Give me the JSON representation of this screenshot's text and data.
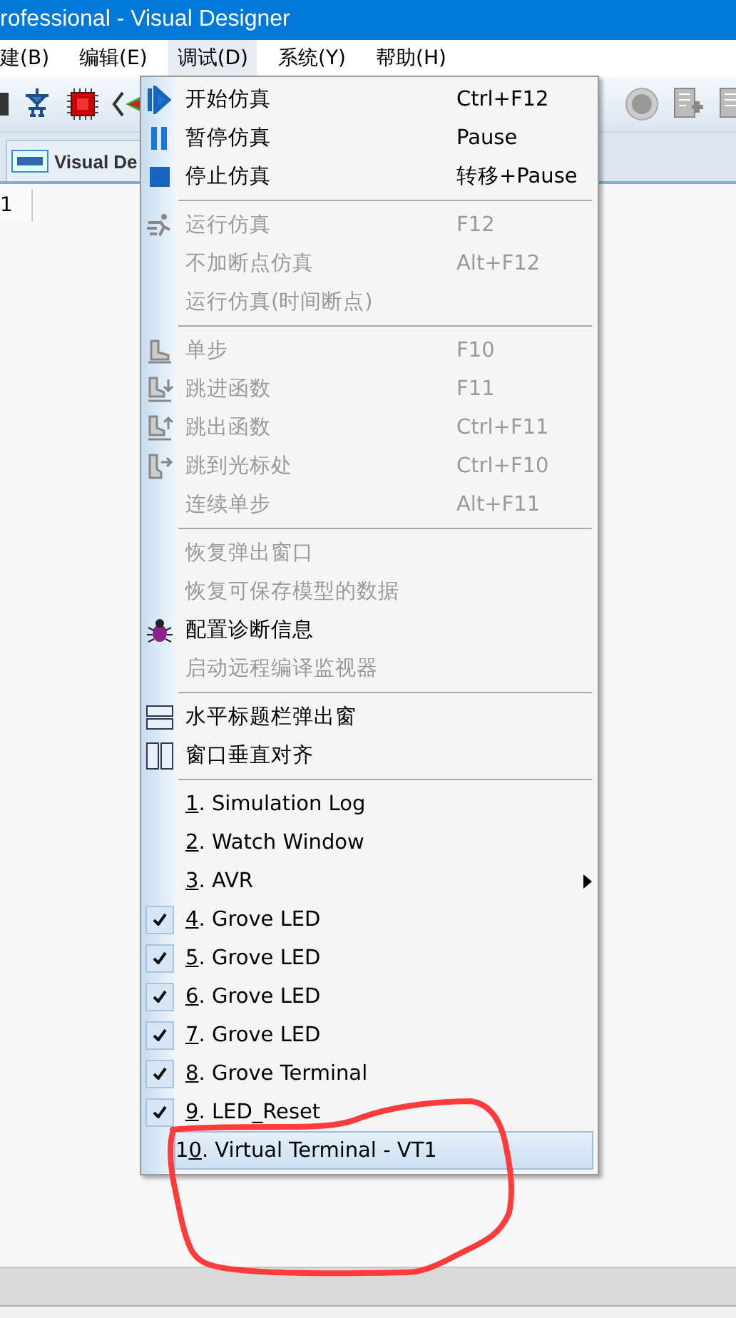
{
  "window": {
    "title": "rofessional - Visual Designer"
  },
  "menu_bar": [
    {
      "label": "建(B)",
      "selected": false
    },
    {
      "label": "编辑(E)",
      "selected": false
    },
    {
      "label": "调试(D)",
      "selected": true
    },
    {
      "label": "系统(Y)",
      "selected": false
    },
    {
      "label": "帮助(H)",
      "selected": false
    }
  ],
  "tabs": [
    {
      "label": "Visual De",
      "selected": true
    }
  ],
  "sheet_tabs": [
    {
      "label": "1",
      "selected": true
    }
  ],
  "menu": {
    "items": [
      {
        "kind": "item",
        "label": "开始仿真",
        "shortcut": "Ctrl+F12",
        "disabled": false,
        "checked": false,
        "selected": false
      },
      {
        "kind": "item",
        "label": "暂停仿真",
        "shortcut": "Pause",
        "disabled": false,
        "checked": false,
        "selected": false
      },
      {
        "kind": "item",
        "label": "停止仿真",
        "shortcut": "转移+Pause",
        "disabled": false,
        "checked": false,
        "selected": false
      },
      {
        "kind": "separator"
      },
      {
        "kind": "item",
        "label": "运行仿真",
        "shortcut": "F12",
        "disabled": true,
        "checked": false,
        "selected": false
      },
      {
        "kind": "item",
        "label": "不加断点仿真",
        "shortcut": "Alt+F12",
        "disabled": true,
        "checked": false,
        "selected": false
      },
      {
        "kind": "item",
        "label": "运行仿真(时间断点)",
        "disabled": true,
        "checked": false,
        "selected": false
      },
      {
        "kind": "separator"
      },
      {
        "kind": "item",
        "label": "单步",
        "shortcut": "F10",
        "disabled": true,
        "checked": false,
        "selected": false
      },
      {
        "kind": "item",
        "label": "跳进函数",
        "shortcut": "F11",
        "disabled": true,
        "checked": false,
        "selected": false
      },
      {
        "kind": "item",
        "label": "跳出函数",
        "shortcut": "Ctrl+F11",
        "disabled": true,
        "checked": false,
        "selected": false
      },
      {
        "kind": "item",
        "label": "跳到光标处",
        "shortcut": "Ctrl+F10",
        "disabled": true,
        "checked": false,
        "selected": false
      },
      {
        "kind": "item",
        "label": "连续单步",
        "shortcut": "Alt+F11",
        "disabled": true,
        "checked": false,
        "selected": false
      },
      {
        "kind": "separator"
      },
      {
        "kind": "item",
        "label": "恢复弹出窗口",
        "disabled": true,
        "checked": false,
        "selected": false
      },
      {
        "kind": "item",
        "label": "恢复可保存模型的数据",
        "disabled": true,
        "checked": false,
        "selected": false
      },
      {
        "kind": "item",
        "label": "配置诊断信息",
        "disabled": false,
        "checked": false,
        "selected": false
      },
      {
        "kind": "item",
        "label": "启动远程编译监视器",
        "disabled": true,
        "checked": false,
        "selected": false
      },
      {
        "kind": "separator"
      },
      {
        "kind": "item",
        "label": "水平标题栏弹出窗",
        "disabled": false,
        "checked": false,
        "selected": false
      },
      {
        "kind": "item",
        "label": "窗口垂直对齐",
        "disabled": false,
        "checked": false,
        "selected": false
      },
      {
        "kind": "separator"
      },
      {
        "kind": "item",
        "key": "1",
        "label": ". Simulation Log",
        "disabled": false,
        "checked": false,
        "selected": false
      },
      {
        "kind": "item",
        "key": "2",
        "label": ". Watch Window",
        "disabled": false,
        "checked": false,
        "selected": false
      },
      {
        "kind": "item",
        "key": "3",
        "label": ". AVR",
        "submenu": true,
        "disabled": false,
        "checked": false,
        "selected": false
      },
      {
        "kind": "item",
        "key": "4",
        "label": ". Grove LED",
        "disabled": false,
        "checked": true,
        "selected": false
      },
      {
        "kind": "item",
        "key": "5",
        "label": ". Grove LED",
        "disabled": false,
        "checked": true,
        "selected": false
      },
      {
        "kind": "item",
        "key": "6",
        "label": ". Grove LED",
        "disabled": false,
        "checked": true,
        "selected": false
      },
      {
        "kind": "item",
        "key": "7",
        "label": ". Grove LED",
        "disabled": false,
        "checked": true,
        "selected": false
      },
      {
        "kind": "item",
        "key": "8",
        "label": ". Grove Terminal",
        "disabled": false,
        "checked": true,
        "selected": false
      },
      {
        "kind": "item",
        "key": "9",
        "label": ". LED_Reset",
        "disabled": false,
        "checked": true,
        "selected": false
      },
      {
        "kind": "item",
        "prefix": "1",
        "key": "0",
        "label": ". Virtual Terminal - VT1",
        "disabled": false,
        "checked": false,
        "selected": true
      }
    ]
  }
}
